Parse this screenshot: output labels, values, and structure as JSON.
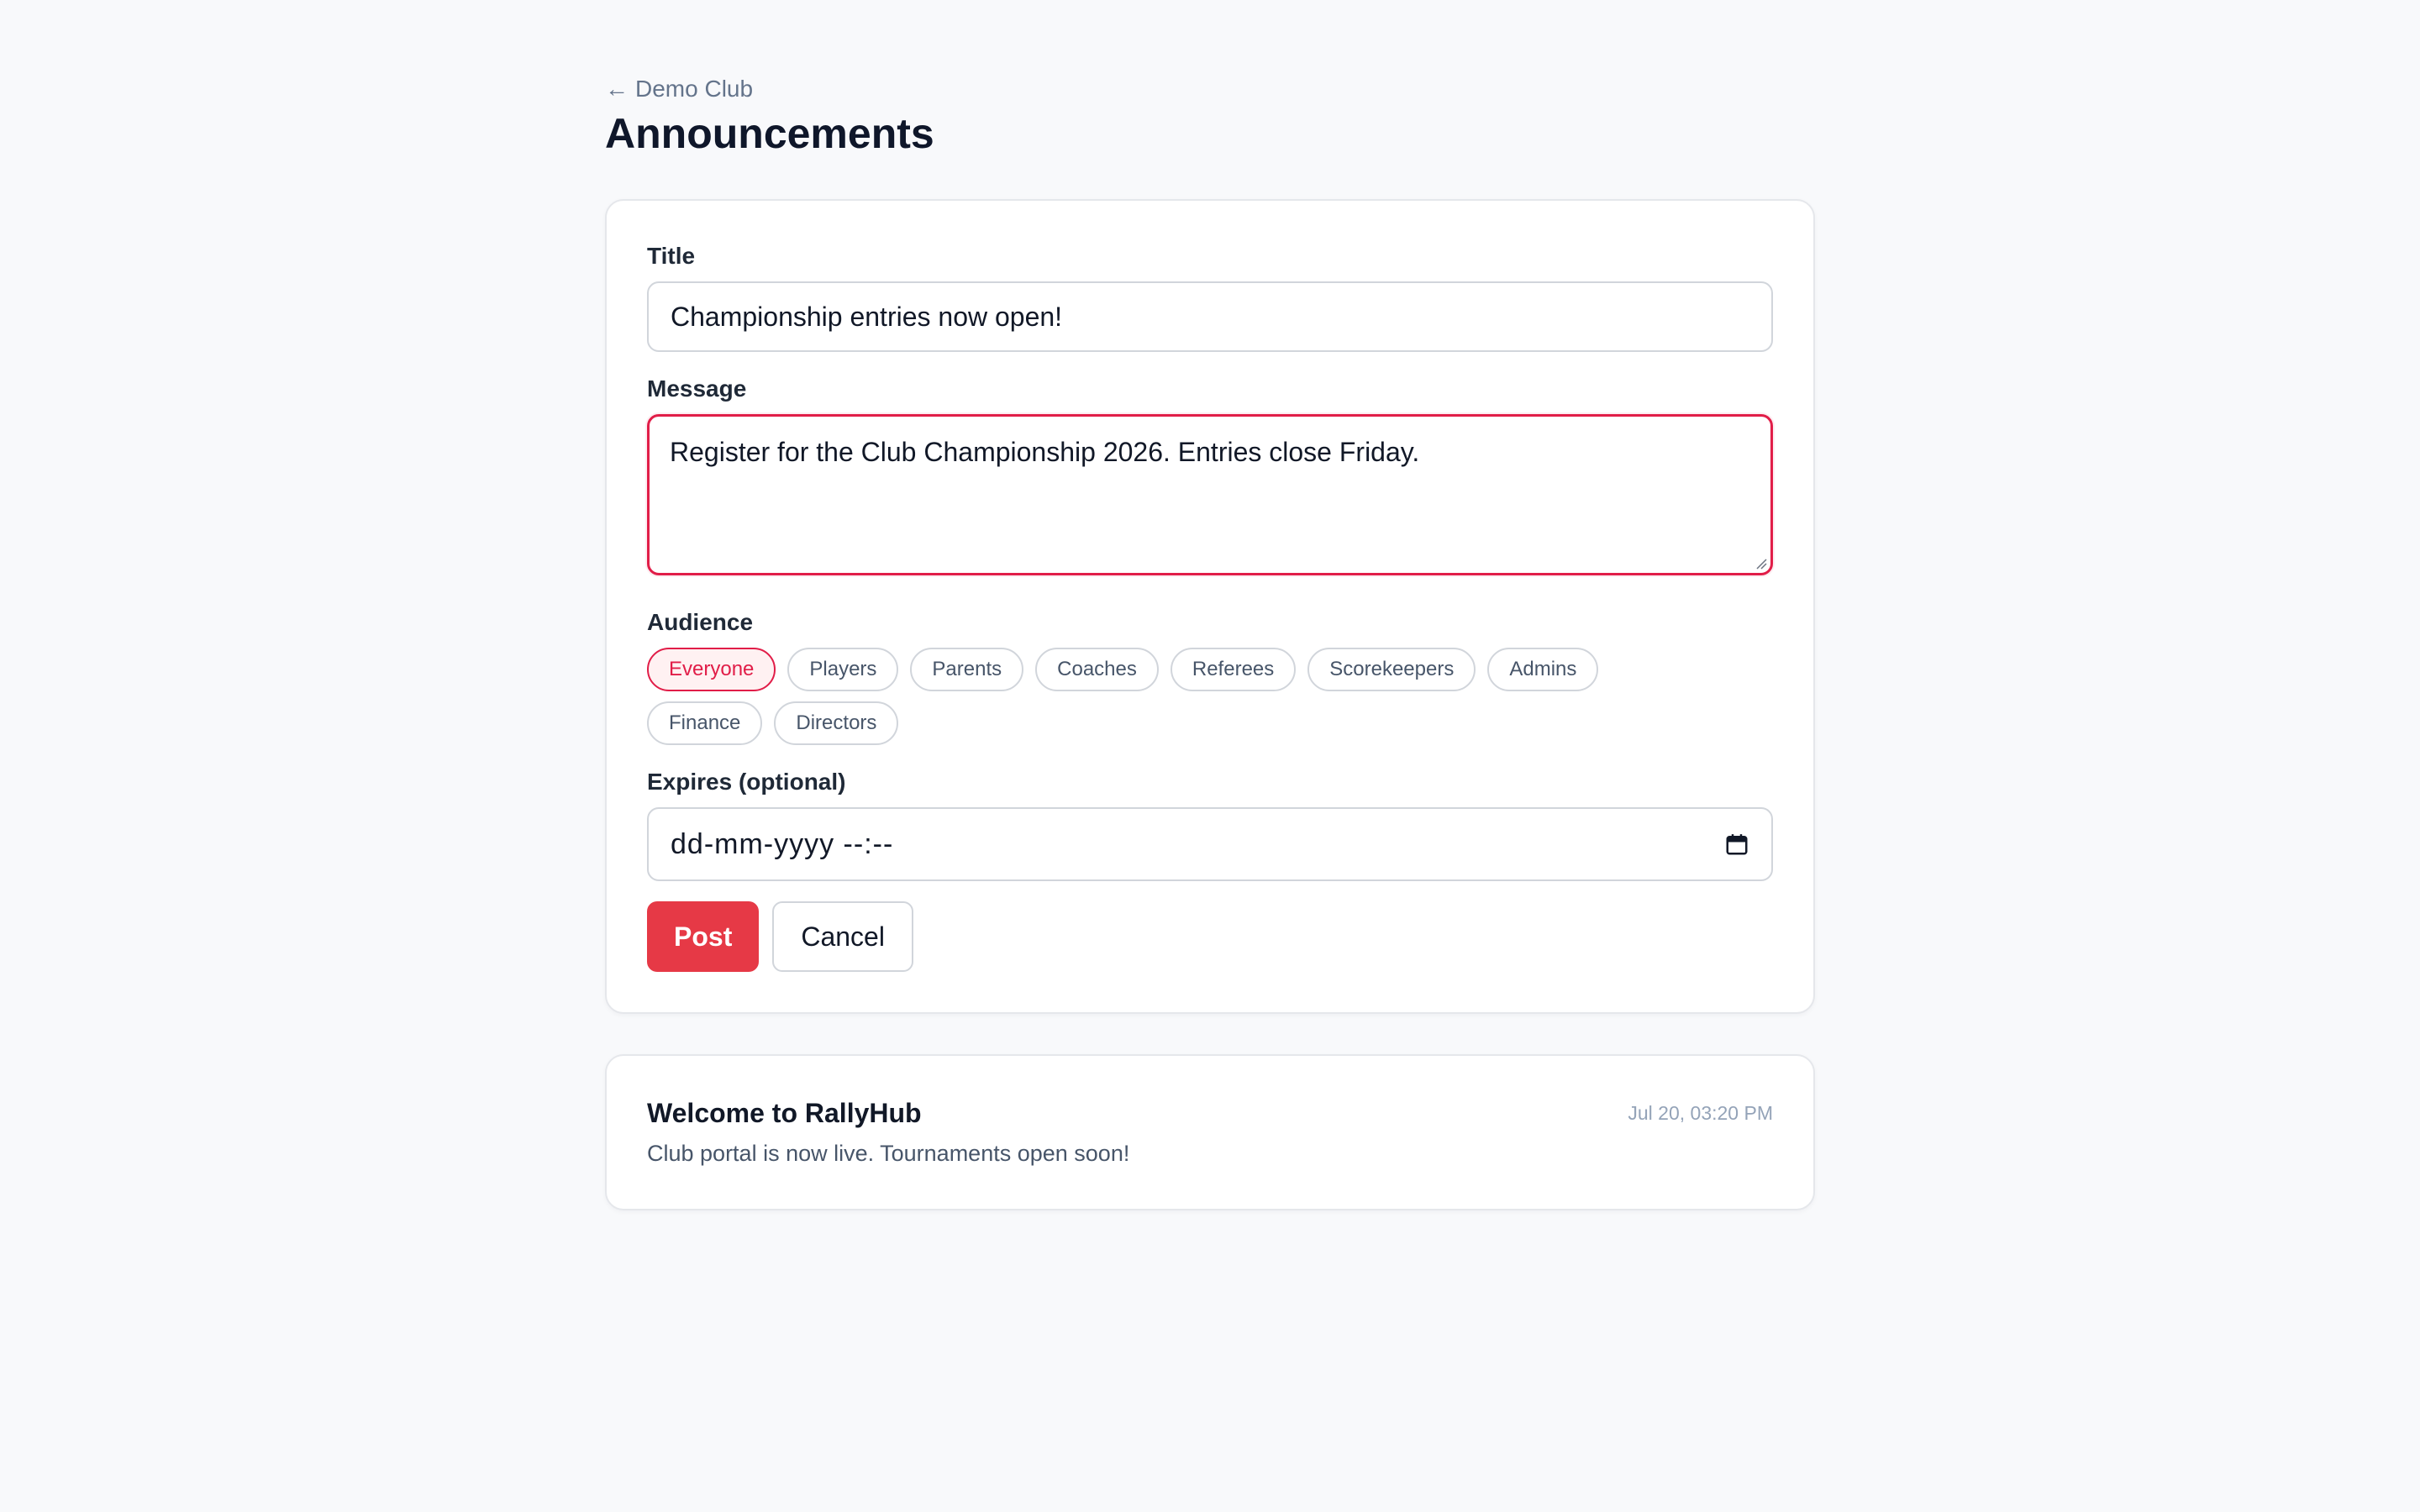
{
  "breadcrumb": {
    "arrow": "←",
    "label": "Demo Club"
  },
  "page": {
    "title": "Announcements"
  },
  "form": {
    "title_label": "Title",
    "title_value": "Championship entries now open!",
    "message_label": "Message",
    "message_value": "Register for the Club Championship 2026. Entries close Friday.",
    "audience_label": "Audience",
    "audience": [
      {
        "label": "Everyone",
        "selected": true
      },
      {
        "label": "Players",
        "selected": false
      },
      {
        "label": "Parents",
        "selected": false
      },
      {
        "label": "Coaches",
        "selected": false
      },
      {
        "label": "Referees",
        "selected": false
      },
      {
        "label": "Scorekeepers",
        "selected": false
      },
      {
        "label": "Admins",
        "selected": false
      },
      {
        "label": "Finance",
        "selected": false
      },
      {
        "label": "Directors",
        "selected": false
      }
    ],
    "expires_label": "Expires (optional)",
    "expires_placeholder": "dd-mm-yyyy --:--",
    "post_label": "Post",
    "cancel_label": "Cancel"
  },
  "announcements": [
    {
      "title": "Welcome to RallyHub",
      "time": "Jul 20, 03:20 PM",
      "body": "Club portal is now live. Tournaments open soon!"
    }
  ],
  "colors": {
    "accent": "#e63946",
    "focus_border": "#e11d48",
    "background": "#f8f9fb"
  }
}
